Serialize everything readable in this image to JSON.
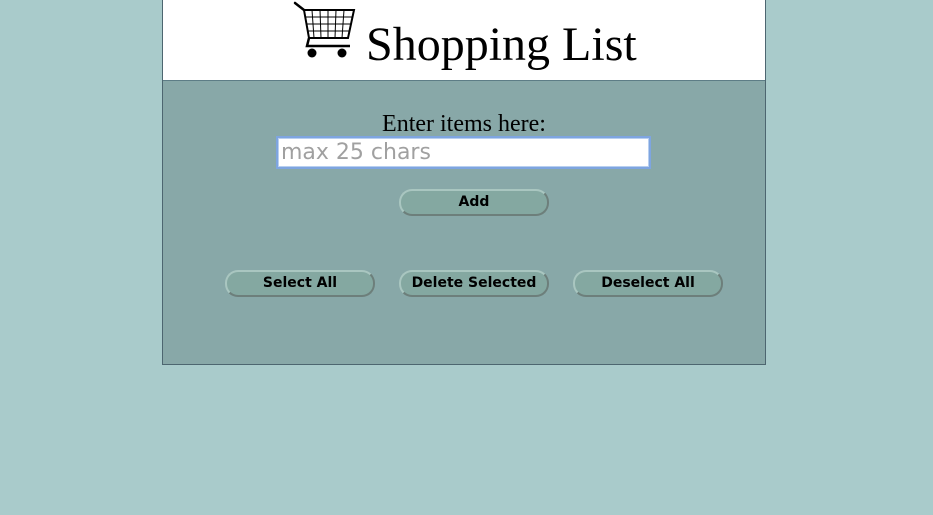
{
  "header": {
    "title": "Shopping List",
    "icon": "shopping-cart-icon"
  },
  "form": {
    "prompt": "Enter items here:",
    "input_value": "",
    "input_placeholder": "max 25 chars",
    "add_label": "Add"
  },
  "actions": {
    "select_all_label": "Select All",
    "delete_selected_label": "Delete Selected",
    "deselect_all_label": "Deselect All"
  },
  "colors": {
    "page_background": "#a9cbcb",
    "panel_background": "#88a8a8",
    "header_background": "#ffffff",
    "button_background": "#84a8a1",
    "input_focus_border": "#7ea5e0"
  }
}
